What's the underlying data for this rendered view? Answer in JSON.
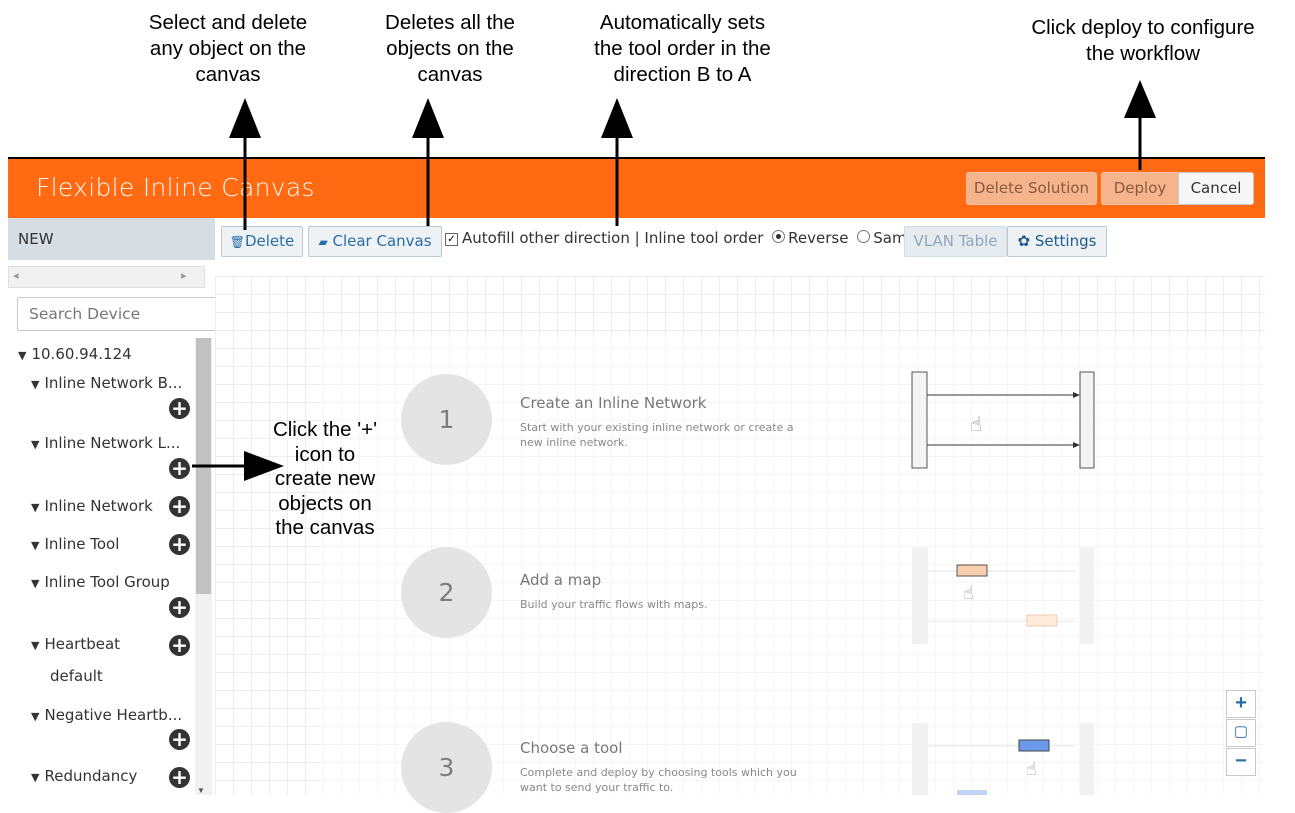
{
  "annotations": {
    "delete_note": [
      "Select and delete",
      "any object on the",
      "canvas"
    ],
    "clear_note": [
      "Deletes all the",
      "objects on the",
      "canvas"
    ],
    "autofill_note": [
      "Automatically sets",
      "the tool order in the",
      "direction B to A"
    ],
    "deploy_note": [
      "Click deploy to configure",
      "the workflow"
    ],
    "plus_note": [
      "Click the '+'",
      "icon to",
      "create new",
      "objects on",
      "the canvas"
    ]
  },
  "header": {
    "title": "Flexible Inline Canvas",
    "delete_solution_label": "Delete Solution",
    "deploy_label": "Deploy",
    "cancel_label": "Cancel",
    "bg_color": "#ff6a13"
  },
  "sidebar": {
    "header": "NEW",
    "search_placeholder": "Search Device",
    "device": "10.60.94.124",
    "items": [
      {
        "label": "Inline Network B..."
      },
      {
        "label": "Inline Network L..."
      },
      {
        "label": "Inline Network"
      },
      {
        "label": "Inline Tool"
      },
      {
        "label": "Inline Tool Group"
      },
      {
        "label": "Heartbeat"
      },
      {
        "label": "default"
      },
      {
        "label": "Negative Heartb..."
      },
      {
        "label": "Redundancy"
      }
    ]
  },
  "toolbar": {
    "delete_label": "Delete",
    "clear_label": "Clear Canvas",
    "autofill_label": "Autofill other direction | Inline tool order",
    "autofill_checked": true,
    "reverse_label": "Reverse",
    "same_label": "Same",
    "selected_order": "Reverse",
    "vlan_label": "VLAN Table",
    "settings_label": "Settings"
  },
  "canvas": {
    "steps": [
      {
        "number": "1",
        "title": "Create an Inline Network",
        "description": "Start with your existing inline network or create a new inline network."
      },
      {
        "number": "2",
        "title": "Add a map",
        "description": "Build your traffic flows with maps."
      },
      {
        "number": "3",
        "title": "Choose a tool",
        "description": "Complete and deploy by choosing tools which you want to send your traffic to."
      }
    ],
    "zoom": {
      "in": "+",
      "reset": "▢",
      "out": "−"
    }
  }
}
